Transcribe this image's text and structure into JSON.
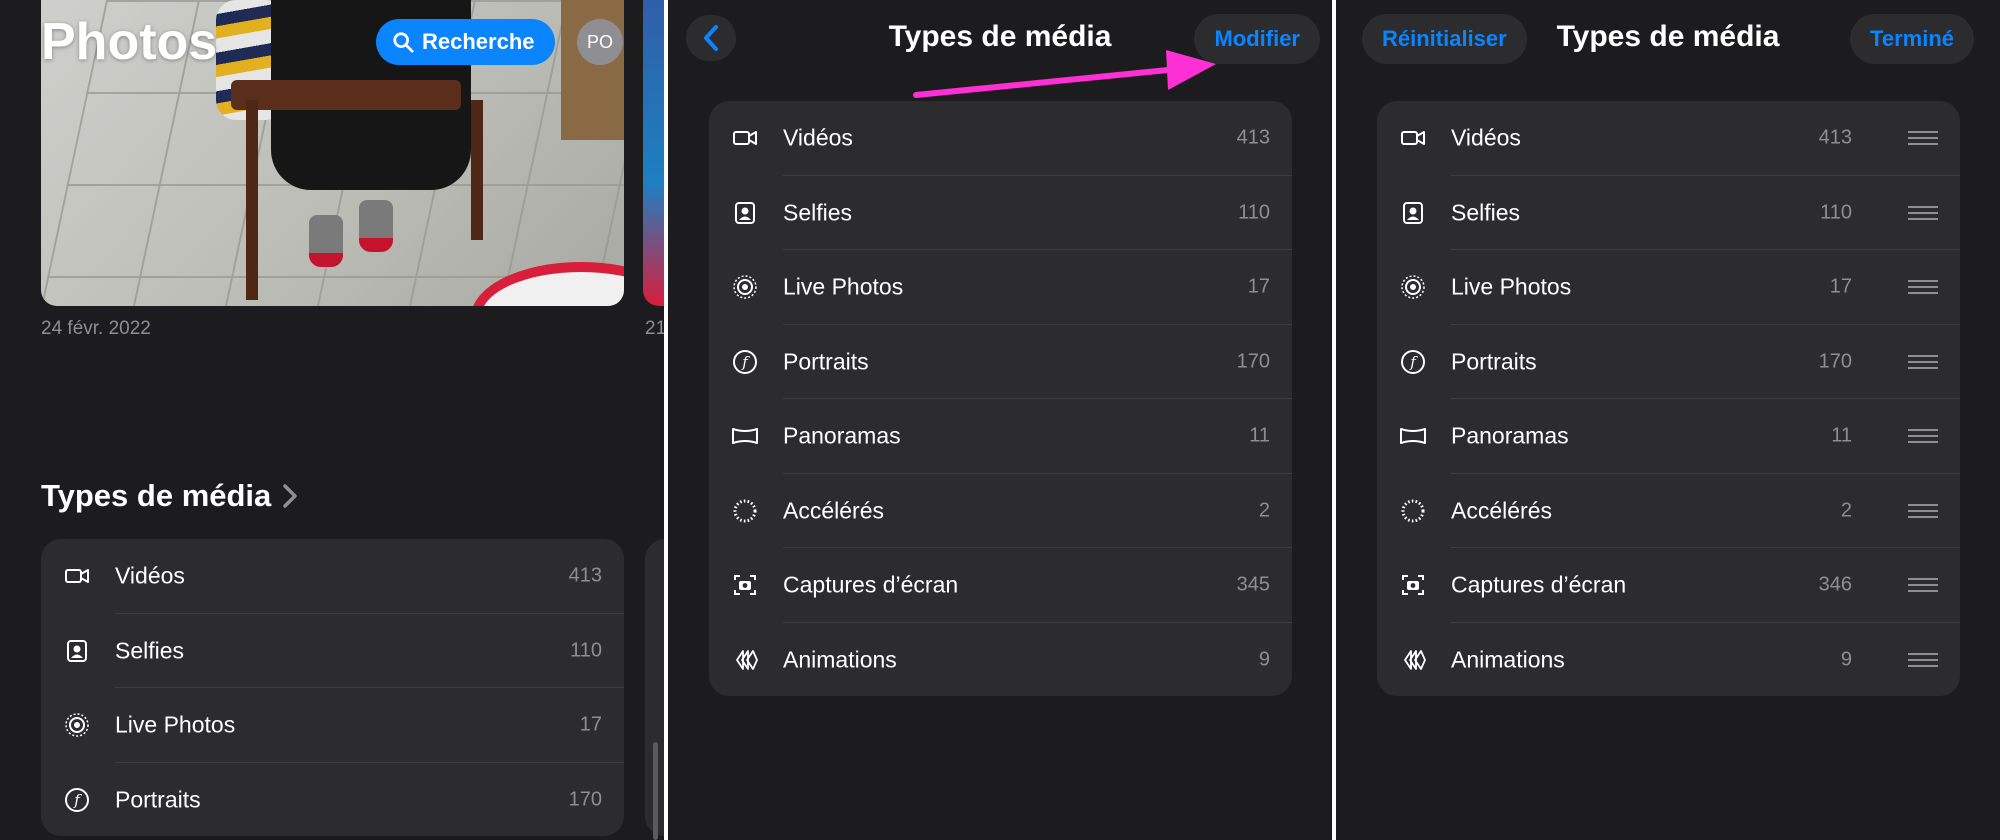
{
  "panel1": {
    "title": "Photos",
    "search_label": "Recherche",
    "avatar_initials": "PO",
    "date_label": "24 févr. 2022",
    "date_label_next": "21",
    "section_title": "Types de média",
    "items": [
      {
        "label": "Vidéos",
        "count": "413",
        "icon": "video-icon"
      },
      {
        "label": "Selfies",
        "count": "110",
        "icon": "selfie-icon"
      },
      {
        "label": "Live Photos",
        "count": "17",
        "icon": "live-photo-icon"
      },
      {
        "label": "Portraits",
        "count": "170",
        "icon": "portrait-icon"
      }
    ]
  },
  "panel2": {
    "title": "Types de média",
    "edit_label": "Modifier",
    "items": [
      {
        "label": "Vidéos",
        "count": "413",
        "icon": "video-icon"
      },
      {
        "label": "Selfies",
        "count": "110",
        "icon": "selfie-icon"
      },
      {
        "label": "Live Photos",
        "count": "17",
        "icon": "live-photo-icon"
      },
      {
        "label": "Portraits",
        "count": "170",
        "icon": "portrait-icon"
      },
      {
        "label": "Panoramas",
        "count": "11",
        "icon": "panorama-icon"
      },
      {
        "label": "Accélérés",
        "count": "2",
        "icon": "timelapse-icon"
      },
      {
        "label": "Captures d’écran",
        "count": "345",
        "icon": "screenshot-icon"
      },
      {
        "label": "Animations",
        "count": "9",
        "icon": "animation-icon"
      }
    ]
  },
  "panel3": {
    "title": "Types de média",
    "reset_label": "Réinitialiser",
    "done_label": "Terminé",
    "items": [
      {
        "label": "Vidéos",
        "count": "413",
        "icon": "video-icon"
      },
      {
        "label": "Selfies",
        "count": "110",
        "icon": "selfie-icon"
      },
      {
        "label": "Live Photos",
        "count": "17",
        "icon": "live-photo-icon"
      },
      {
        "label": "Portraits",
        "count": "170",
        "icon": "portrait-icon"
      },
      {
        "label": "Panoramas",
        "count": "11",
        "icon": "panorama-icon"
      },
      {
        "label": "Accélérés",
        "count": "2",
        "icon": "timelapse-icon"
      },
      {
        "label": "Captures d’écran",
        "count": "346",
        "icon": "screenshot-icon"
      },
      {
        "label": "Animations",
        "count": "9",
        "icon": "animation-icon"
      }
    ]
  },
  "colors": {
    "background": "#1c1c1e",
    "card": "#2c2c2e",
    "accent": "#0a84ff",
    "secondary_text": "#8e8e93",
    "annotation_arrow": "#ff2fd6",
    "divider": "#ffffff"
  }
}
